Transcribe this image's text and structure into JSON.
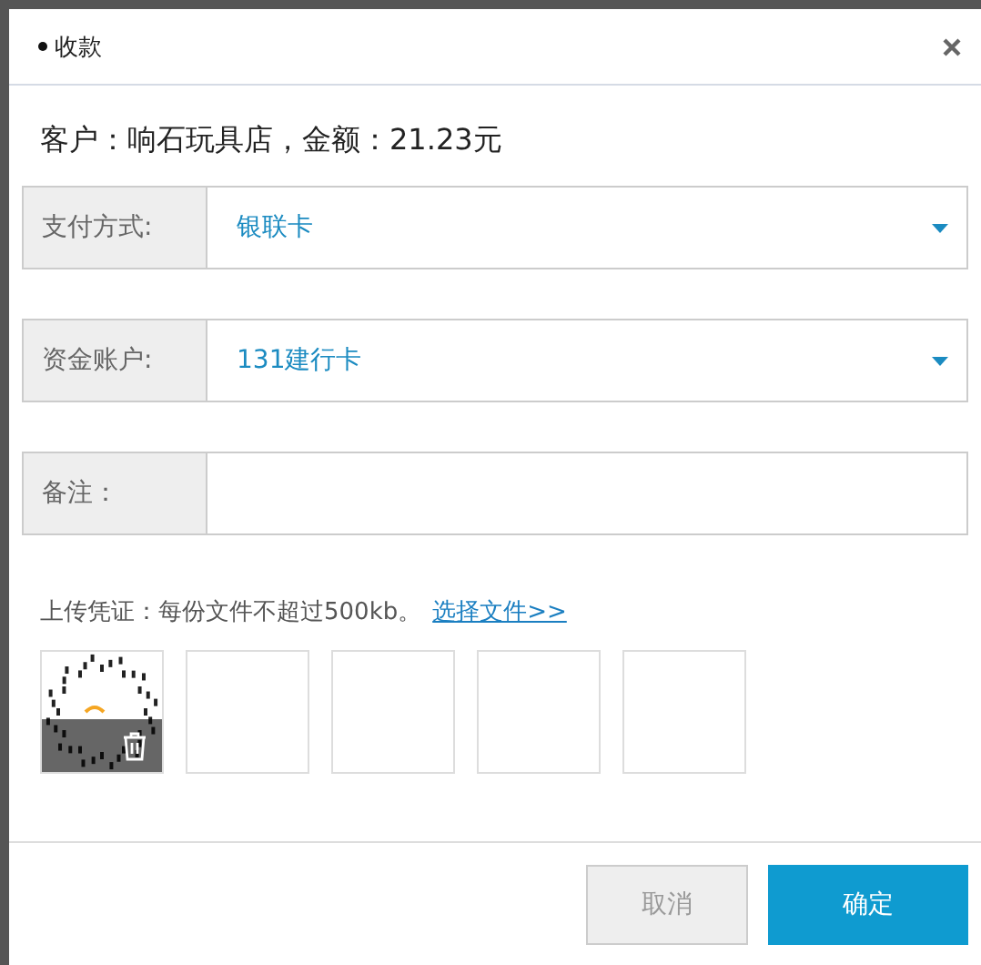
{
  "dialog": {
    "title": "收款"
  },
  "summary": "客户：响石玩具店，金额：21.23元",
  "fields": [
    {
      "kind": "select",
      "label": "支付方式:",
      "value": "银联卡"
    },
    {
      "kind": "select",
      "label": "资金账户:",
      "value": "131建行卡"
    },
    {
      "kind": "text",
      "label": "备注："
    }
  ],
  "upload": {
    "hint": "上传凭证：每份文件不超过500kb。",
    "link": "选择文件>>",
    "slots": [
      {
        "kind": "picture"
      },
      {
        "kind": "empty"
      },
      {
        "kind": "empty"
      },
      {
        "kind": "empty"
      },
      {
        "kind": "empty"
      }
    ]
  },
  "buttons": [
    {
      "kind": "cancel",
      "label": "取消"
    },
    {
      "kind": "primary",
      "label": "确定"
    }
  ]
}
